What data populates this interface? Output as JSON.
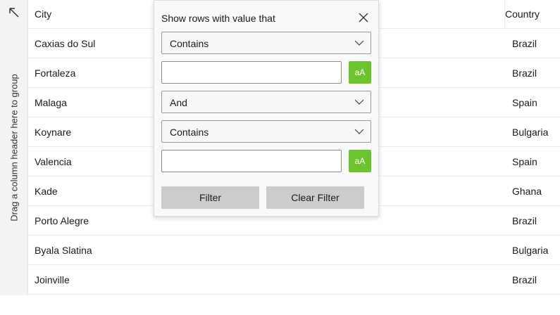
{
  "group_panel": {
    "text": "Drag a column header here to group",
    "collapse_icon": "arrow-up-left-icon"
  },
  "grid": {
    "columns": {
      "city": "City",
      "country": "Country"
    },
    "rows": [
      {
        "city": "Caxias do Sul",
        "country": "Brazil"
      },
      {
        "city": "Fortaleza",
        "country": "Brazil"
      },
      {
        "city": "Malaga",
        "country": "Spain"
      },
      {
        "city": "Koynare",
        "country": "Bulgaria"
      },
      {
        "city": "Valencia",
        "country": "Spain"
      },
      {
        "city": "Kade",
        "country": "Ghana"
      },
      {
        "city": "Porto Alegre",
        "country": "Brazil"
      },
      {
        "city": "Byala Slatina",
        "country": "Bulgaria"
      },
      {
        "city": "Joinville",
        "country": "Brazil"
      }
    ]
  },
  "filter_popup": {
    "title": "Show rows with value that",
    "close_icon": "close-icon",
    "operator1": "Contains",
    "value1": "",
    "match_case1": "aA",
    "logical_operator": "And",
    "operator2": "Contains",
    "value2": "",
    "match_case2": "aA",
    "filter_label": "Filter",
    "clear_filter_label": "Clear Filter",
    "accent_color": "#6bc42e"
  }
}
